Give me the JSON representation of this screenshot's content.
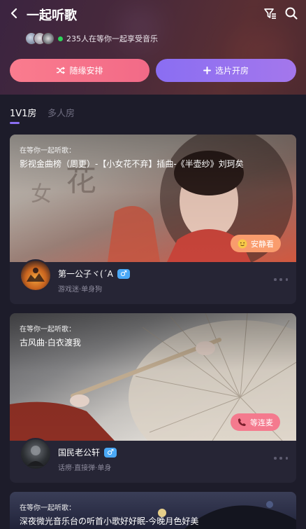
{
  "header": {
    "title": "一起听歌",
    "listeners_text": "235人在等你一起享受音乐",
    "random_button": "随缘安排",
    "create_button": "选片开房"
  },
  "tabs": [
    {
      "label": "1V1房",
      "active": true
    },
    {
      "label": "多人房",
      "active": false
    }
  ],
  "rooms": [
    {
      "waiting_label": "在等你一起听歌：",
      "song": "影视金曲榜（周更）-【小女花不弃】插曲-《半壶纱》刘珂矣",
      "status": "安静看",
      "status_icon": "smile-emoji-icon",
      "host_name": "第一公子ヾ(´A",
      "host_gender": "♂",
      "host_tags": "游戏迷·单身狗"
    },
    {
      "waiting_label": "在等你一起听歌：",
      "song": "古风曲·白衣渡我",
      "status": "等连麦",
      "status_icon": "phone-icon",
      "host_name": "国民老公轩",
      "host_gender": "♂",
      "host_tags": "话痨·直接弹·单身"
    },
    {
      "waiting_label": "在等你一起听歌：",
      "song": "深夜微光音乐台の听首小歌好好眠-今晚月色好美"
    }
  ],
  "colors": {
    "accent_purple": "#8a6ef2",
    "accent_pink": "#f26a87",
    "online_green": "#2ed35a",
    "gender_blue": "#4aa8f5"
  }
}
